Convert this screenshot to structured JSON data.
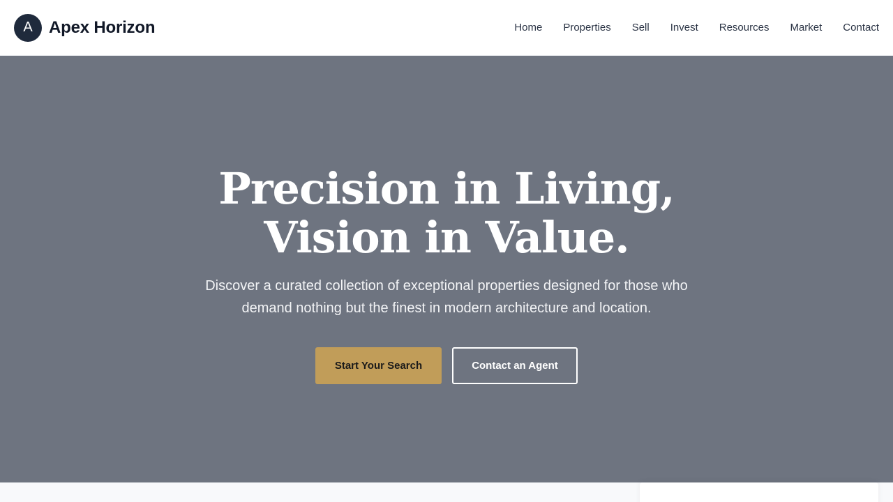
{
  "brand": {
    "logo_letter": "A",
    "name": "Apex Horizon"
  },
  "nav": {
    "items": [
      {
        "label": "Home"
      },
      {
        "label": "Properties"
      },
      {
        "label": "Sell"
      },
      {
        "label": "Invest"
      },
      {
        "label": "Resources"
      },
      {
        "label": "Market"
      },
      {
        "label": "Contact"
      }
    ]
  },
  "hero": {
    "title_line1": "Precision in Living,",
    "title_line2": "Vision in Value.",
    "subtitle": "Discover a curated collection of exceptional properties designed for those who demand nothing but the finest in modern architecture and location.",
    "primary_button": "Start Your Search",
    "secondary_button": "Contact an Agent"
  },
  "colors": {
    "navy": "#1f2a3c",
    "gold": "#c19d59",
    "hero_overlay": "#6e7480"
  }
}
